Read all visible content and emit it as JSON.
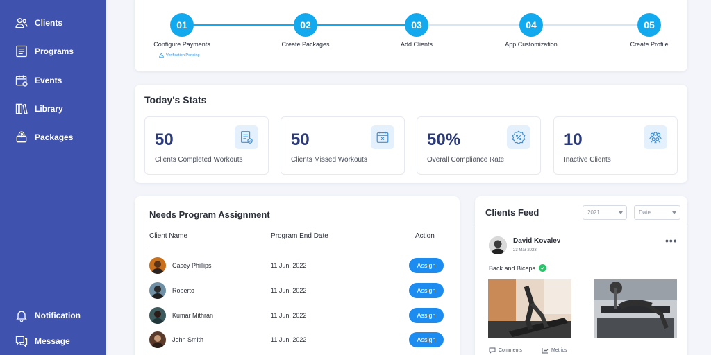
{
  "sidebar": {
    "items": [
      {
        "label": "Clients",
        "icon": "users-icon"
      },
      {
        "label": "Programs",
        "icon": "list-icon"
      },
      {
        "label": "Events",
        "icon": "calendar-icon"
      },
      {
        "label": "Library",
        "icon": "books-icon"
      },
      {
        "label": "Packages",
        "icon": "package-icon"
      }
    ],
    "bottom": [
      {
        "label": "Notification",
        "icon": "bell-icon"
      },
      {
        "label": "Message",
        "icon": "chat-icon"
      }
    ]
  },
  "steps": {
    "items": [
      {
        "number": "01",
        "label": "Configure Payments"
      },
      {
        "number": "02",
        "label": "Create Packages"
      },
      {
        "number": "03",
        "label": "Add Clients"
      },
      {
        "number": "04",
        "label": "App Customization"
      },
      {
        "number": "05",
        "label": "Create Profile"
      }
    ],
    "sub_label": "Verification Pending"
  },
  "stats": {
    "title": "Today's Stats",
    "items": [
      {
        "value": "50",
        "label": "Clients Completed Workouts",
        "icon": "clipboard-check-icon"
      },
      {
        "value": "50",
        "label": "Clients Missed Workouts",
        "icon": "calendar-x-icon"
      },
      {
        "value": "50%",
        "label": "Overall Compliance Rate",
        "icon": "percent-badge-icon"
      },
      {
        "value": "10",
        "label": "Inactive Clients",
        "icon": "group-icon"
      }
    ]
  },
  "assignment": {
    "title": "Needs Program Assignment",
    "columns": [
      "Client Name",
      "Program End Date",
      "Action"
    ],
    "rows": [
      {
        "name": "Casey Phillips",
        "date": "11 Jun, 2022",
        "action": "Assign"
      },
      {
        "name": "Roberto",
        "date": "11 Jun, 2022",
        "action": "Assign"
      },
      {
        "name": "Kumar Mithran",
        "date": "11 Jun, 2022",
        "action": "Assign"
      },
      {
        "name": "John Smith",
        "date": "11 Jun, 2022",
        "action": "Assign"
      }
    ]
  },
  "feed": {
    "title": "Clients Feed",
    "year_select": "2021",
    "date_select": "Date",
    "post": {
      "name": "David Kovalev",
      "date": "23 Mar 2023",
      "workout": "Back and Biceps",
      "comments_label": "Comments",
      "metrics_label": "Metrics"
    }
  },
  "colors": {
    "sidebar": "#3f52ae",
    "accent": "#1d8cf0",
    "step_active": "#12a9ef",
    "success": "#2cc36b"
  }
}
